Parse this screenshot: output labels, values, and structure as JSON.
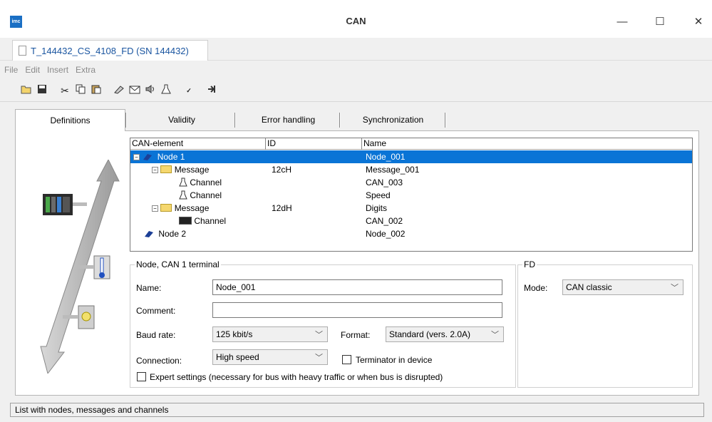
{
  "window": {
    "title": "CAN",
    "app_icon_text": "imc",
    "minimize": "—",
    "maximize": "☐",
    "close": "✕"
  },
  "doc_tab": {
    "label": "T_144432_CS_4108_FD (SN 144432)"
  },
  "menu": [
    "File",
    "Edit",
    "Insert",
    "Extra"
  ],
  "toolbar": [
    "open-icon",
    "save-icon",
    "cut-icon",
    "copy-icon",
    "paste-icon",
    "node-icon",
    "message-icon",
    "speaker-icon",
    "channel-icon",
    "can-check-icon",
    "export-icon"
  ],
  "tabs": [
    "Definitions",
    "Validity",
    "Error handling",
    "Synchronization"
  ],
  "tree": {
    "headers": [
      "CAN-element",
      "ID",
      "Name"
    ],
    "rows": [
      {
        "element": "Node 1",
        "id": "",
        "name": "Node_001"
      },
      {
        "element": "Message",
        "id": "12cH",
        "name": "Message_001"
      },
      {
        "element": "Channel",
        "id": "",
        "name": "CAN_003"
      },
      {
        "element": "Channel",
        "id": "",
        "name": "Speed"
      },
      {
        "element": "Message",
        "id": "12dH",
        "name": "Digits"
      },
      {
        "element": "Channel",
        "id": "",
        "name": "CAN_002"
      },
      {
        "element": "Node 2",
        "id": "",
        "name": "Node_002"
      }
    ]
  },
  "node_group": {
    "title": "Node, CAN 1 terminal",
    "name_label": "Name:",
    "name_value": "Node_001",
    "comment_label": "Comment:",
    "comment_value": "",
    "baud_label": "Baud rate:",
    "baud_value": "125 kbit/s",
    "format_label": "Format:",
    "format_value": "Standard (vers. 2.0A)",
    "connection_label": "Connection:",
    "connection_value": "High speed",
    "terminator_label": "Terminator in device",
    "expert_label": "Expert settings (necessary for bus with heavy traffic or when bus is disrupted)"
  },
  "fd_group": {
    "title": "FD",
    "mode_label": "Mode:",
    "mode_value": "CAN classic"
  },
  "status": {
    "text": "List with nodes, messages and channels"
  }
}
